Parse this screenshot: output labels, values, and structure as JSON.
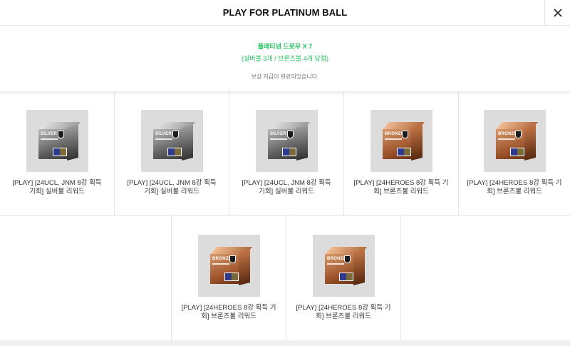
{
  "header": {
    "title": "PLAY FOR PLATINUM BALL",
    "close_icon": "close-icon"
  },
  "summary": {
    "headline": "플래티넘 드로우 X 7",
    "detail": "(실버볼 3개 / 브론즈볼 4개 당첨)",
    "status": "보상 지급이 완료되었습니다."
  },
  "colors": {
    "accent_green": "#21c25e",
    "thumb_bg": "#dcdcdc"
  },
  "rewards": [
    {
      "tier": "SILVER",
      "label": "[PLAY] [24UCL, JNM 8강 획득 기회] 실버볼 리워드"
    },
    {
      "tier": "SILVER",
      "label": "[PLAY] [24UCL, JNM 8강 획득 기회] 실버볼 리워드"
    },
    {
      "tier": "SILVER",
      "label": "[PLAY] [24UCL, JNM 8강 획득 기회] 실버볼 리워드"
    },
    {
      "tier": "BRONZE",
      "label": "[PLAY] [24HEROES 8강 획득 기회] 브론즈볼 리워드"
    },
    {
      "tier": "BRONZE",
      "label": "[PLAY] [24HEROES 8강 획득 기회] 브론즈볼 리워드"
    },
    {
      "tier": "BRONZE",
      "label": "[PLAY] [24HEROES 8강 획득 기회] 브론즈볼 리워드"
    },
    {
      "tier": "BRONZE",
      "label": "[PLAY] [24HEROES 8강 획득 기회] 브론즈볼 리워드"
    }
  ]
}
